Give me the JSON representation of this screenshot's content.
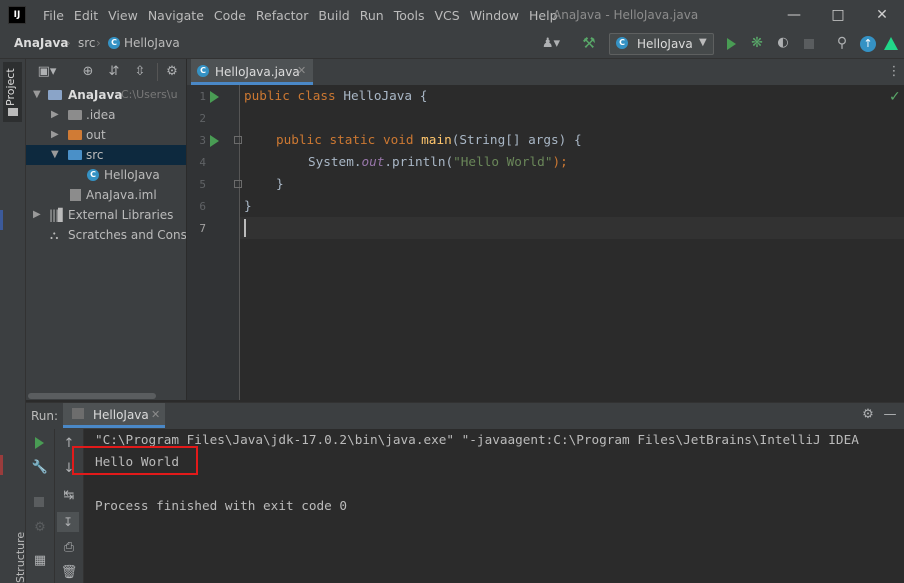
{
  "app": {
    "logo_text": "IJ",
    "window_title": "AnaJava - HelloJava.java",
    "menu": [
      "File",
      "Edit",
      "View",
      "Navigate",
      "Code",
      "Refactor",
      "Build",
      "Run",
      "Tools",
      "VCS",
      "Window",
      "Help"
    ]
  },
  "navbar": {
    "breadcrumbs": [
      "AnaJava",
      "src",
      "HelloJava"
    ],
    "run_config": "HelloJava"
  },
  "sidebar": {
    "project_tab": "Project",
    "structure_tab": "Structure"
  },
  "project_tree": {
    "root": "AnaJava",
    "root_path": "C:\\Users\\u",
    "items": [
      ".idea",
      "out",
      "src",
      "HelloJava",
      "AnaJava.iml",
      "External Libraries",
      "Scratches and Consoles"
    ]
  },
  "editor": {
    "tab_label": "HelloJava.java",
    "line_numbers": [
      "1",
      "2",
      "3",
      "4",
      "5",
      "6",
      "7"
    ],
    "code": {
      "l1_kw1": "public",
      "l1_kw2": "class",
      "l1_name": "HelloJava {",
      "l3_kw1": "public",
      "l3_kw2": "static",
      "l3_kw3": "void",
      "l3_fn": "main",
      "l3_rest": "(String[] args) {",
      "l4_a": "System.",
      "l4_b": "out",
      "l4_c": ".println(",
      "l4_str": "\"Hello World\"",
      "l4_d": ");",
      "l5": "}",
      "l6": "}"
    }
  },
  "run_panel": {
    "label": "Run:",
    "tab_label": "HelloJava",
    "console_lines": [
      "\"C:\\Program Files\\Java\\jdk-17.0.2\\bin\\java.exe\" \"-javaagent:C:\\Program Files\\JetBrains\\IntelliJ IDEA",
      "Hello World",
      "",
      "Process finished with exit code 0"
    ]
  },
  "colors": {
    "highlight_box": "#e21a1a",
    "accent_tab": "#4a88c7",
    "run_green": "#499c54"
  }
}
